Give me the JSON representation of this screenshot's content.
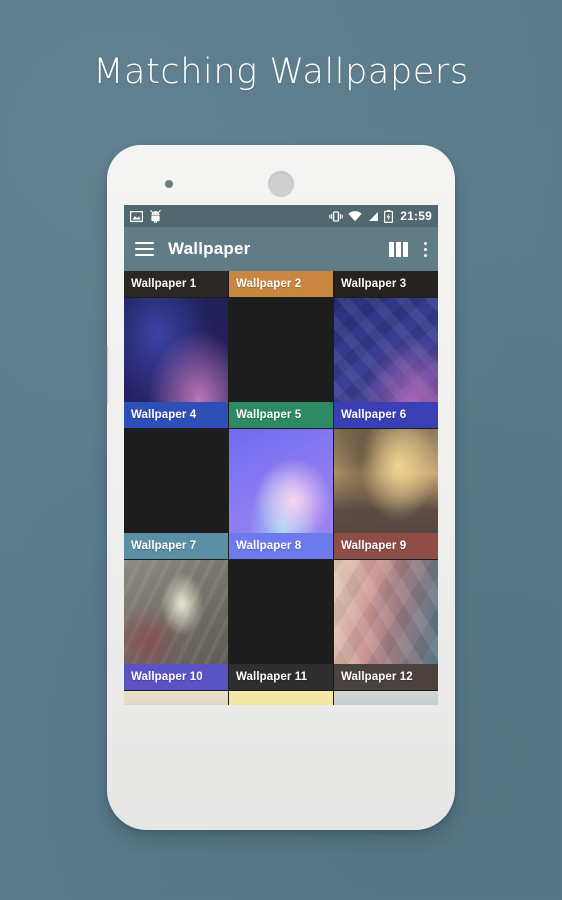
{
  "page": {
    "headline": "Matching Wallpapers",
    "background_color": "#5a7b8c"
  },
  "phone": {
    "sensor_icon": "proximity-sensor",
    "speaker_icon": "earpiece-speaker"
  },
  "status_bar": {
    "background_color": "#52686f",
    "left_icons": [
      "image-icon",
      "android-robot-icon"
    ],
    "right_icons": [
      "vibrate-icon",
      "wifi-icon",
      "cellular-signal-icon",
      "battery-charging-icon"
    ],
    "clock": "21:59"
  },
  "toolbar": {
    "background_color": "#627c85",
    "menu_icon": "hamburger-menu-icon",
    "title": "Wallpaper",
    "columns_icon": "column-layout-icon",
    "overflow_icon": "overflow-menu-icon"
  },
  "grid": {
    "columns": 3,
    "tiles": [
      {
        "label": "Wallpaper 1",
        "art": "w1",
        "label_color": "#2b2724",
        "cropped": "top"
      },
      {
        "label": "Wallpaper 2",
        "art": "w2",
        "label_color": "#c98641",
        "cropped": "top"
      },
      {
        "label": "Wallpaper 3",
        "art": "w3",
        "label_color": "#26221f",
        "cropped": "top"
      },
      {
        "label": "Wallpaper 4",
        "art": "w4",
        "label_color": "#2f4fb8",
        "cropped": ""
      },
      {
        "label": "Wallpaper 5",
        "art": "w5",
        "label_color": "#2d8a63",
        "cropped": ""
      },
      {
        "label": "Wallpaper 6",
        "art": "w6",
        "label_color": "#3a3fb5",
        "cropped": ""
      },
      {
        "label": "Wallpaper 7",
        "art": "w7",
        "label_color": "#5b8fa3",
        "cropped": ""
      },
      {
        "label": "Wallpaper 8",
        "art": "w8",
        "label_color": "#6f79ee",
        "cropped": ""
      },
      {
        "label": "Wallpaper 9",
        "art": "w9",
        "label_color": "#8e4d46",
        "cropped": ""
      },
      {
        "label": "Wallpaper 10",
        "art": "w10",
        "label_color": "#5b52c4",
        "cropped": ""
      },
      {
        "label": "Wallpaper 11",
        "art": "w11",
        "label_color": "#2e2e2e",
        "cropped": ""
      },
      {
        "label": "Wallpaper 12",
        "art": "w12",
        "label_color": "#4b423d",
        "cropped": ""
      },
      {
        "label": "",
        "art": "w13",
        "label_color": "transparent",
        "cropped": "bottom"
      },
      {
        "label": "",
        "art": "w14",
        "label_color": "transparent",
        "cropped": "bottom"
      },
      {
        "label": "",
        "art": "w15",
        "label_color": "transparent",
        "cropped": "bottom"
      }
    ]
  },
  "nav_bar": {
    "background_color": "#1c1c1c",
    "back_icon": "back-triangle-icon",
    "home_icon": "home-circle-icon",
    "recents_icon": "recents-square-icon"
  }
}
